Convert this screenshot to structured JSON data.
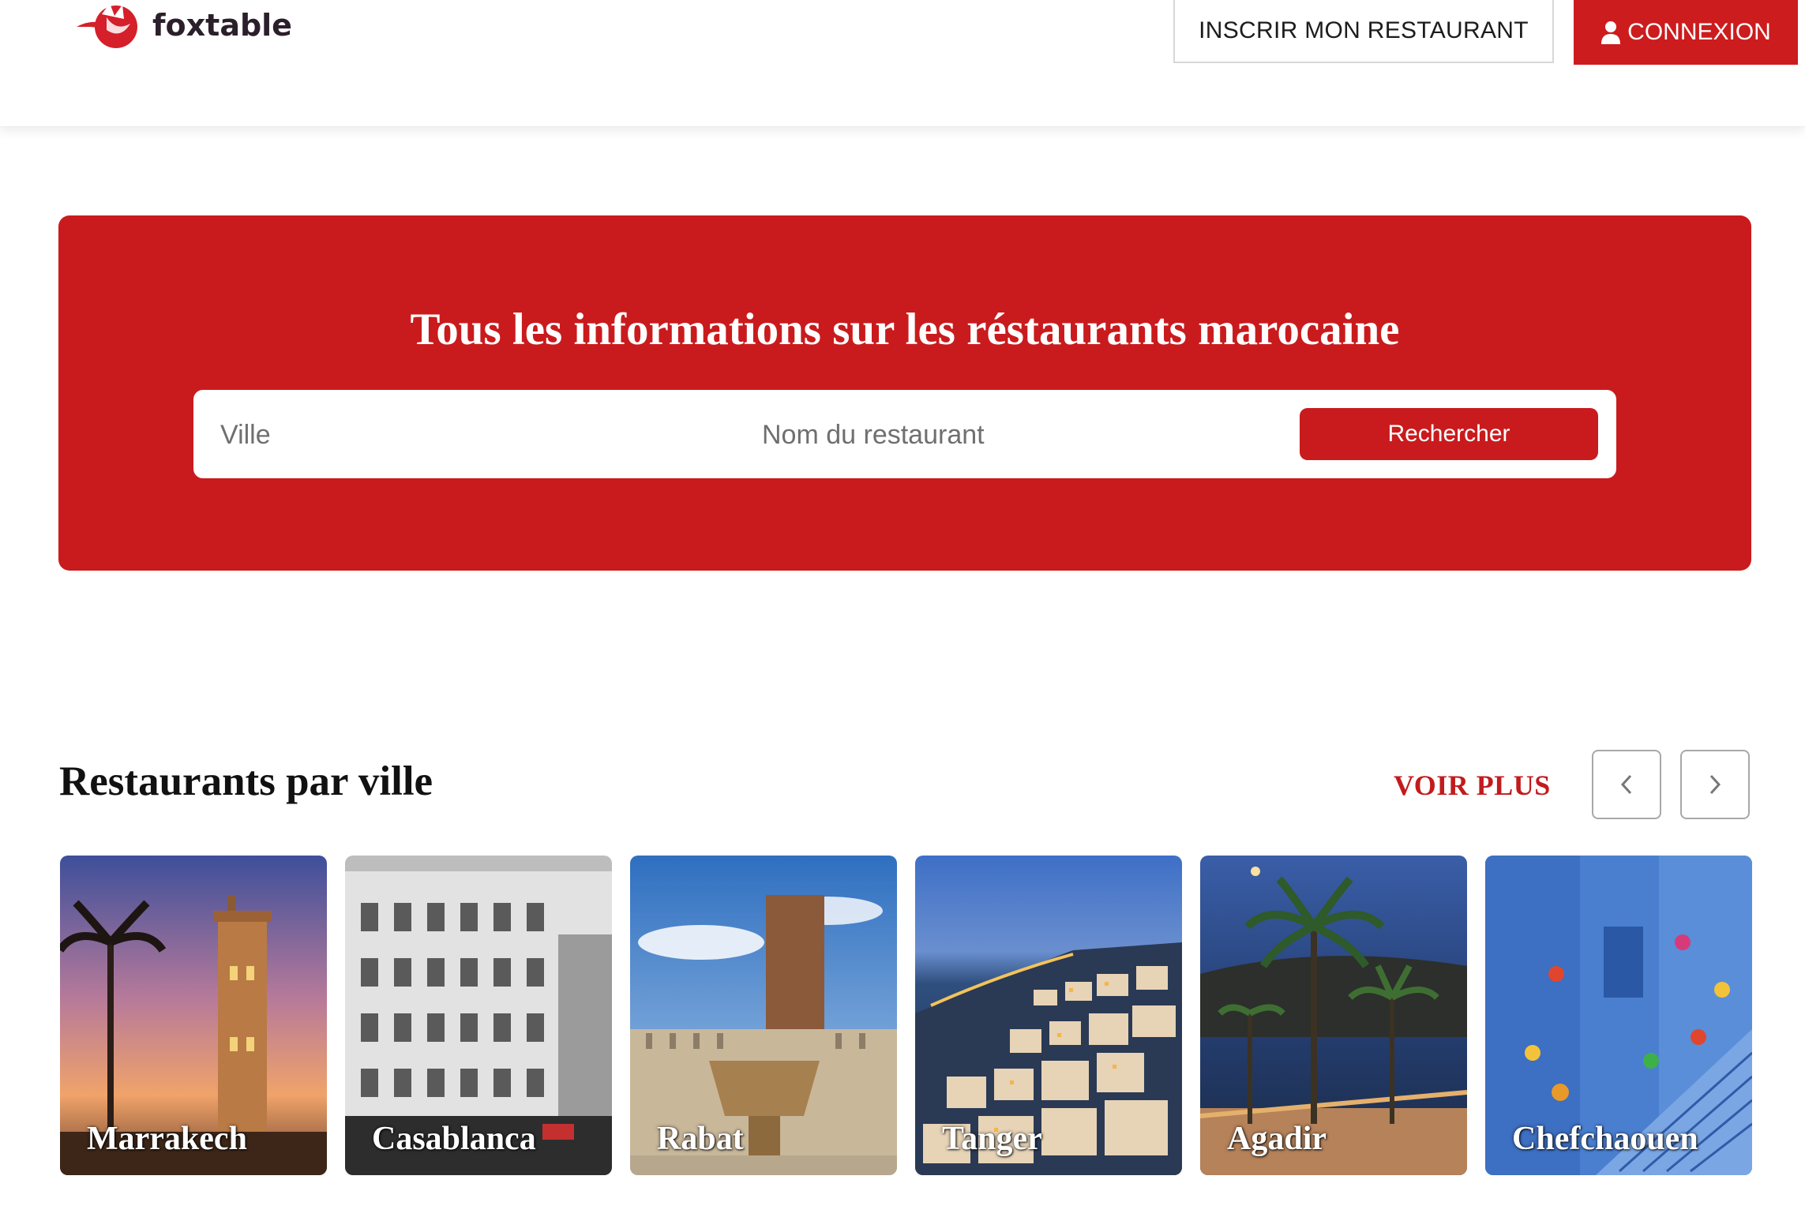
{
  "brand": {
    "name": "foxtable",
    "primary_color": "#c91b1d"
  },
  "header": {
    "register_label": "INSCRIR MON RESTAURANT",
    "login_label": "CONNEXION",
    "login_icon": "user-icon"
  },
  "hero": {
    "title": "Tous les informations sur les réstaurants marocaine",
    "search": {
      "city_placeholder": "Ville",
      "name_placeholder": "Nom du restaurant",
      "button_label": "Rechercher"
    }
  },
  "cities_section": {
    "title": "Restaurants par ville",
    "see_more_label": "VOIR PLUS",
    "prev_icon": "chevron-left-icon",
    "next_icon": "chevron-right-icon",
    "cities": [
      {
        "name": "Marrakech"
      },
      {
        "name": "Casablanca"
      },
      {
        "name": "Rabat"
      },
      {
        "name": "Tanger"
      },
      {
        "name": "Agadir"
      },
      {
        "name": "Chefchaouen"
      }
    ]
  }
}
